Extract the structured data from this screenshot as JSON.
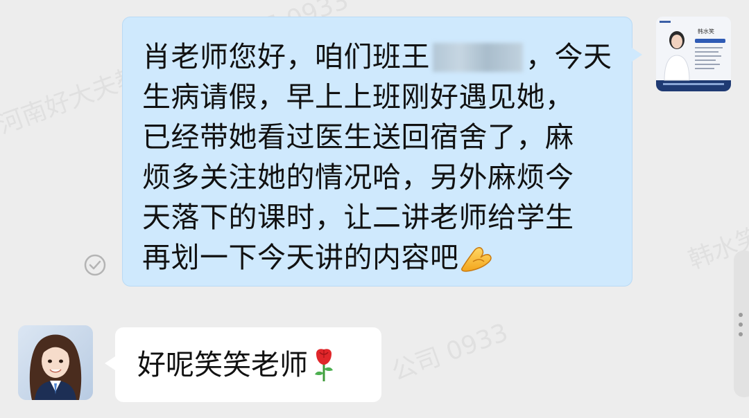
{
  "watermark": {
    "company": "河南好大夫教育",
    "phone": "公司 0933",
    "name": "韩水笑"
  },
  "conversation": {
    "sent_message": {
      "lines": [
        [
          "肖老师您好，咱们班王",
          "，今天"
        ],
        "生病请假，早上上班刚好遇见她，",
        "已经带她看过医生送回宿舍了，麻",
        "烦多关注她的情况哈，另外麻烦今",
        "天落下的课时，让二讲老师给学生",
        "再划一下今天讲的内容吧"
      ],
      "emoji": "ok-hand",
      "status_icon": "check-circle-icon"
    },
    "sent_avatar_card": {
      "name": "韩水笑"
    },
    "received_message": {
      "text": "好呢笑笑老师",
      "emoji": "rose"
    }
  },
  "colors": {
    "sent_bubble": "#cfe9fd",
    "received_bubble": "#ffffff",
    "background": "#ededed"
  }
}
